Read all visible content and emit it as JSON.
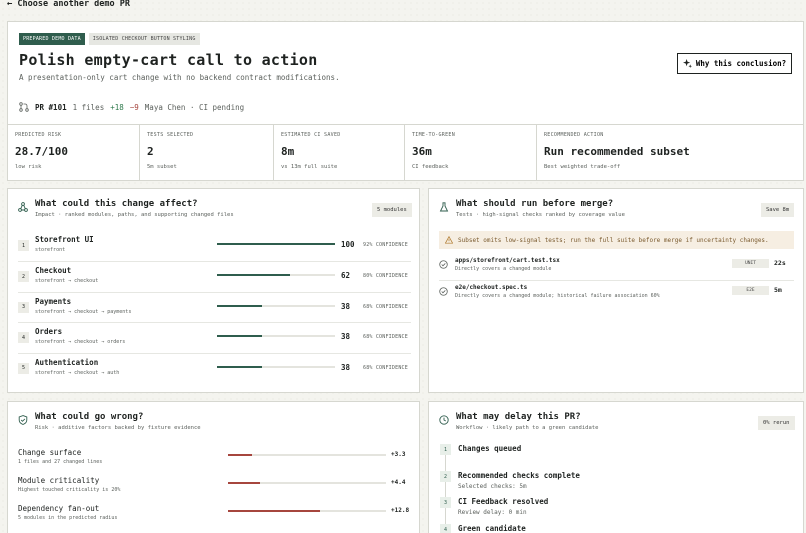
{
  "nav": {
    "back_label": "Choose another demo PR"
  },
  "hero": {
    "badges": [
      "PREPARED DEMO DATA",
      "ISOLATED CHECKOUT BUTTON STYLING"
    ],
    "title": "Polish empty-cart call to action",
    "subtitle": "A presentation-only cart change with no backend contract modifications.",
    "why_button": "Why this conclusion?",
    "pr": {
      "number": "PR #101",
      "files": "1 files",
      "added": "+18",
      "removed": "−9",
      "author_status": "Maya Chen · CI pending"
    },
    "metrics": [
      {
        "label": "PREDICTED RISK",
        "value": "28.7/100",
        "sub": "low risk"
      },
      {
        "label": "TESTS SELECTED",
        "value": "2",
        "sub": "5m subset"
      },
      {
        "label": "ESTIMATED CI SAVED",
        "value": "8m",
        "sub": "vs 13m full suite"
      },
      {
        "label": "TIME-TO-GREEN",
        "value": "36m",
        "sub": "CI feedback"
      },
      {
        "label": "RECOMMENDED ACTION",
        "value": "Run recommended subset",
        "sub": "Best weighted trade-off"
      }
    ]
  },
  "impact": {
    "title": "What could this change affect?",
    "subtitle": "Impact · ranked modules, paths, and supporting changed files",
    "chip": "5 modules",
    "modules": [
      {
        "num": "1",
        "name": "Storefront UI",
        "path": "storefront",
        "score": 100,
        "score_label": "100",
        "conf": "92% CONFIDENCE"
      },
      {
        "num": "2",
        "name": "Checkout",
        "path": "storefront → checkout",
        "score": 62,
        "score_label": "62",
        "conf": "80% CONFIDENCE"
      },
      {
        "num": "3",
        "name": "Payments",
        "path": "storefront → checkout → payments",
        "score": 38,
        "score_label": "38",
        "conf": "68% CONFIDENCE"
      },
      {
        "num": "4",
        "name": "Orders",
        "path": "storefront → checkout → orders",
        "score": 38,
        "score_label": "38",
        "conf": "68% CONFIDENCE"
      },
      {
        "num": "5",
        "name": "Authentication",
        "path": "storefront → checkout → auth",
        "score": 38,
        "score_label": "38",
        "conf": "68% CONFIDENCE"
      }
    ]
  },
  "tests": {
    "title": "What should run before merge?",
    "subtitle": "Tests · high-signal checks ranked by coverage value",
    "chip": "Save 8m",
    "warning": "Subset omits low-signal tests; run the full suite before merge if uncertainty changes.",
    "items": [
      {
        "name": "apps/storefront/cart.test.tsx",
        "desc": "Directly covers a changed module",
        "kind": "UNIT",
        "time": "22s"
      },
      {
        "name": "e2e/checkout.spec.ts",
        "desc": "Directly covers a changed module; historical failure association 60%",
        "kind": "E2E",
        "time": "5m"
      }
    ]
  },
  "risk": {
    "title": "What could go wrong?",
    "subtitle": "Risk · additive factors backed by fixture evidence",
    "factors": [
      {
        "name": "Change surface",
        "sub": "1 files and 27 changed lines",
        "fraction": 0.15,
        "value": "+3.3"
      },
      {
        "name": "Module criticality",
        "sub": "Highest touched criticality is 20%",
        "fraction": 0.2,
        "value": "+4.4"
      },
      {
        "name": "Dependency fan-out",
        "sub": "5 modules in the predicted radius",
        "fraction": 0.58,
        "value": "+12.8"
      }
    ]
  },
  "delay": {
    "title": "What may delay this PR?",
    "subtitle": "Workflow · likely path to a green candidate",
    "chip": "0% rerun",
    "steps": [
      {
        "num": "1",
        "title": "Changes queued",
        "sub": ""
      },
      {
        "num": "2",
        "title": "Recommended checks complete",
        "sub": "Selected checks: 5m"
      },
      {
        "num": "3",
        "title": "CI Feedback resolved",
        "sub": "Review delay: 0 min"
      },
      {
        "num": "4",
        "title": "Green candidate",
        "sub": ""
      }
    ]
  },
  "colors": {
    "accent": "#2f5d4d",
    "risk": "#a6463e",
    "warning_bg": "#f6eee2"
  }
}
